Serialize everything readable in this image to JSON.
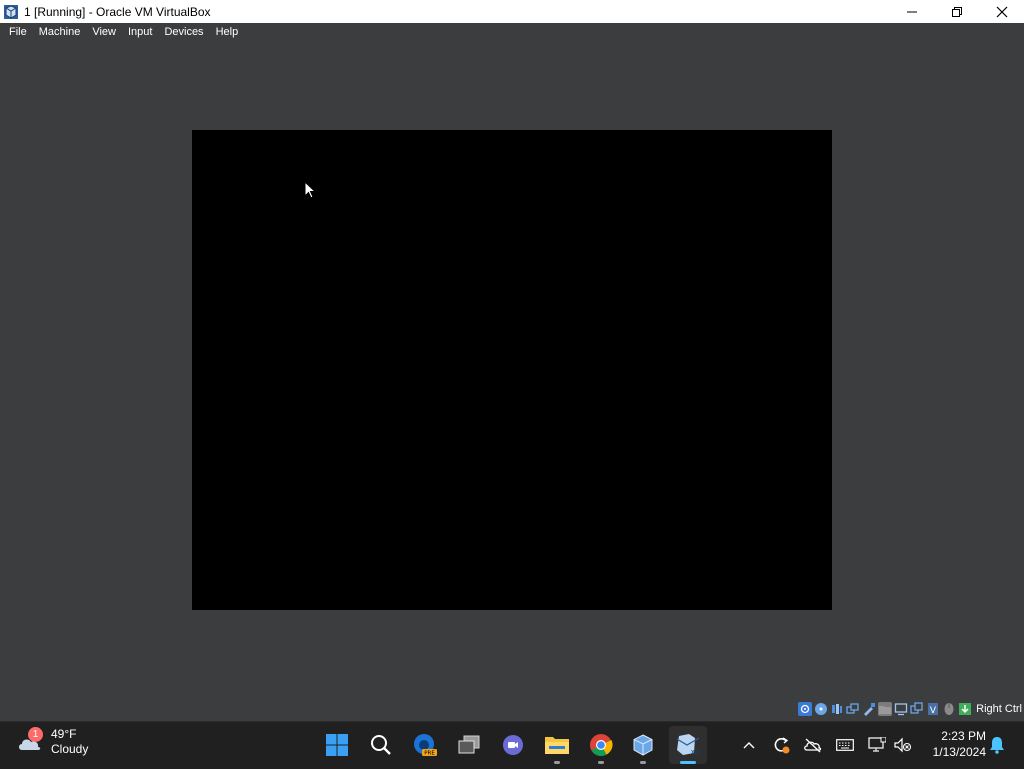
{
  "window": {
    "title": "1 [Running] - Oracle VM VirtualBox"
  },
  "menu": {
    "items": [
      "File",
      "Machine",
      "View",
      "Input",
      "Devices",
      "Help"
    ]
  },
  "statusbar": {
    "icons": [
      "hard-disk-icon",
      "optical-drive-icon",
      "audio-icon",
      "network-icon",
      "usb-icon",
      "shared-folders-icon",
      "display-icon",
      "recording-icon",
      "virtualization-icon",
      "mouse-integration-icon",
      "keyboard-capture-icon"
    ],
    "host_key": "Right Ctrl"
  },
  "taskbar": {
    "weather": {
      "temperature": "49°F",
      "condition": "Cloudy",
      "badge": "1"
    },
    "apps": [
      "start-button",
      "search-button",
      "edge-preview",
      "task-view",
      "meet-chat",
      "file-explorer",
      "chrome",
      "virtualbox-manager",
      "virtualbox-vm-window"
    ],
    "clock": {
      "time": "2:23 PM",
      "date": "1/13/2024"
    }
  },
  "colors": {
    "window_bg": "#3c3d3f",
    "vm_screen": "#000000",
    "taskbar": "#202020",
    "accent": "#4cc2ff"
  }
}
